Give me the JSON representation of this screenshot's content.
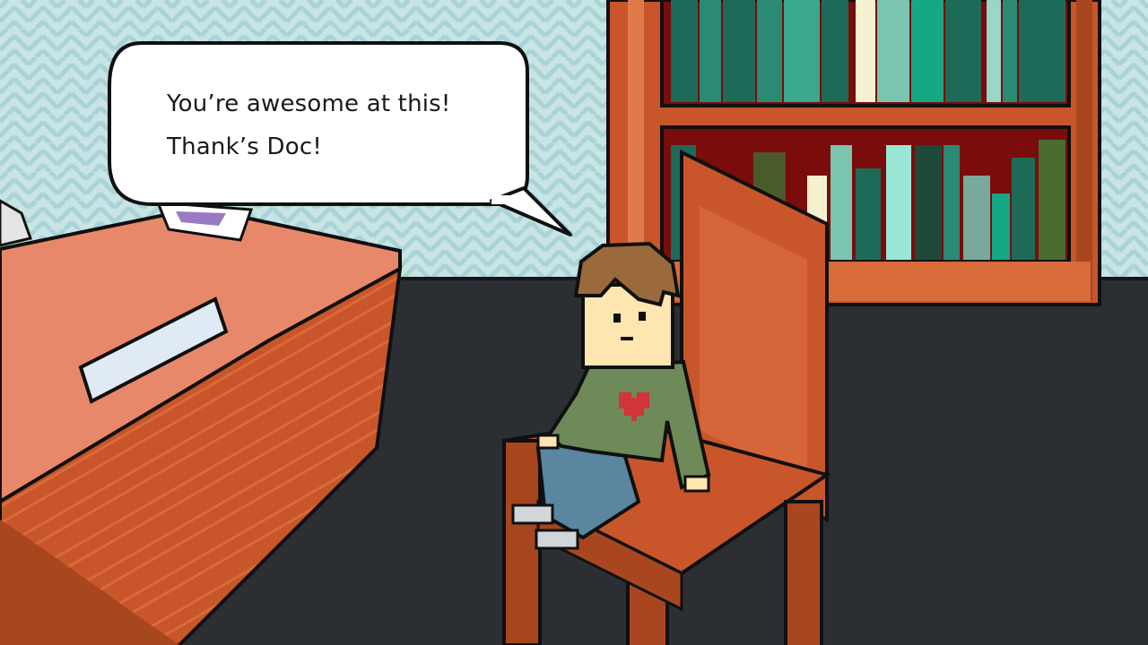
{
  "dialogue": {
    "line1": "You’re awesome at this!",
    "line2": "Thank’s Doc!"
  },
  "colors": {
    "wall": "#c8e4e4",
    "floor": "#2b2f33",
    "wood": "#c8562a",
    "desk_top": "#e8886a",
    "sweater": "#6e8a58",
    "heart": "#d2343a",
    "jeans": "#5a86a0",
    "hair": "#9a6a3c"
  }
}
